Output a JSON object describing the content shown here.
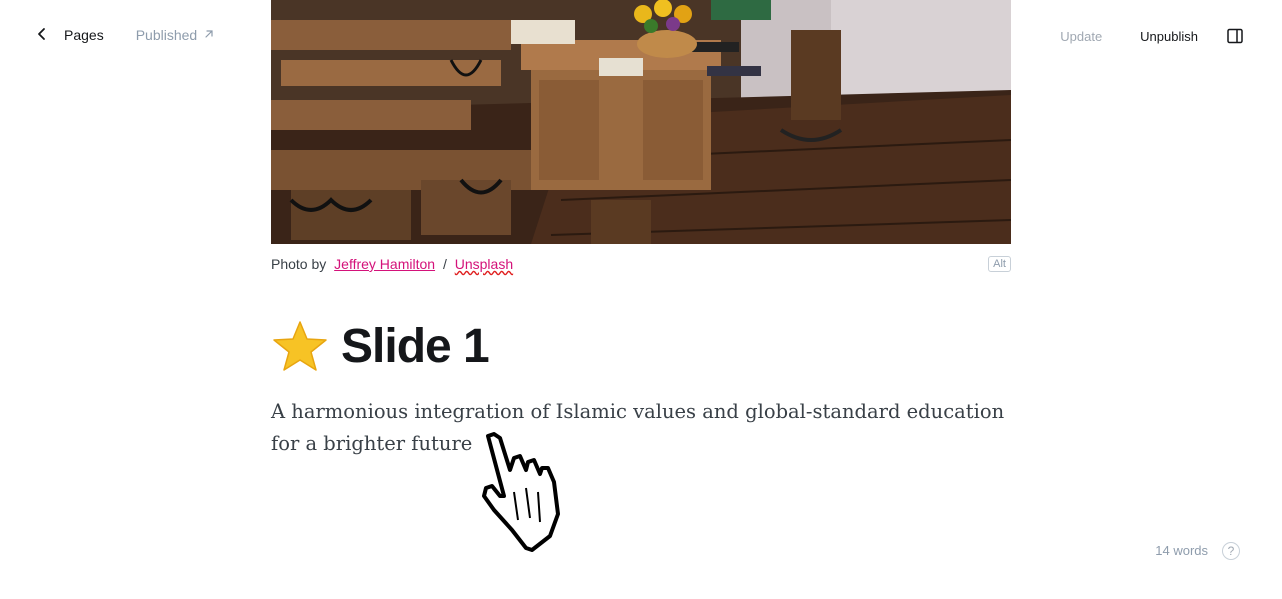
{
  "topbar": {
    "back_label": "Pages",
    "status_label": "Published",
    "update_label": "Update",
    "unpublish_label": "Unpublish"
  },
  "feature_image": {
    "caption_prefix": "Photo by",
    "author": "Jeffrey Hamilton",
    "separator": "/",
    "source": "Unsplash",
    "alt_button": "Alt"
  },
  "post": {
    "title": "Slide 1",
    "body": "A harmonious integration of Islamic values and global-standard education for a brighter future"
  },
  "footer": {
    "word_count": "14 words",
    "help": "?"
  },
  "icons": {
    "back": "chevron-left-icon",
    "status": "arrow-up-right-icon",
    "sidebar": "sidebar-toggle-icon",
    "title_emoji": "star-icon",
    "cursor": "hand-pointer-icon"
  },
  "colors": {
    "accent_link": "#d4127a",
    "muted": "#8e9cac",
    "text": "#15171a"
  }
}
